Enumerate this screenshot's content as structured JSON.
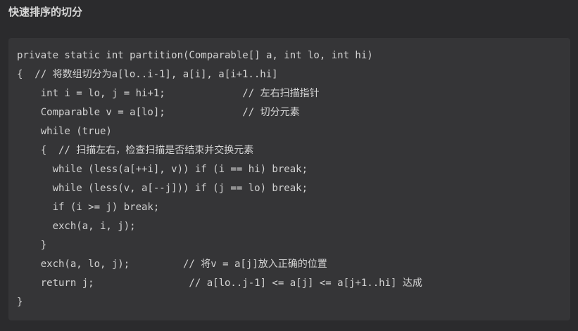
{
  "title": "快速排序的切分",
  "code_lines": [
    "private static int partition(Comparable[] a, int lo, int hi)",
    "{  // 将数组切分为a[lo..i-1], a[i], a[i+1..hi]",
    "    int i = lo, j = hi+1;             // 左右扫描指针",
    "    Comparable v = a[lo];             // 切分元素",
    "    while (true)",
    "    {  // 扫描左右，检查扫描是否结束并交换元素",
    "      while (less(a[++i], v)) if (i == hi) break;",
    "      while (less(v, a[--j])) if (j == lo) break;",
    "      if (i >= j) break;",
    "      exch(a, i, j);",
    "    }",
    "    exch(a, lo, j);         // 将v = a[j]放入正确的位置",
    "    return j;                // a[lo..j-1] <= a[j] <= a[j+1..hi] 达成",
    "}"
  ]
}
